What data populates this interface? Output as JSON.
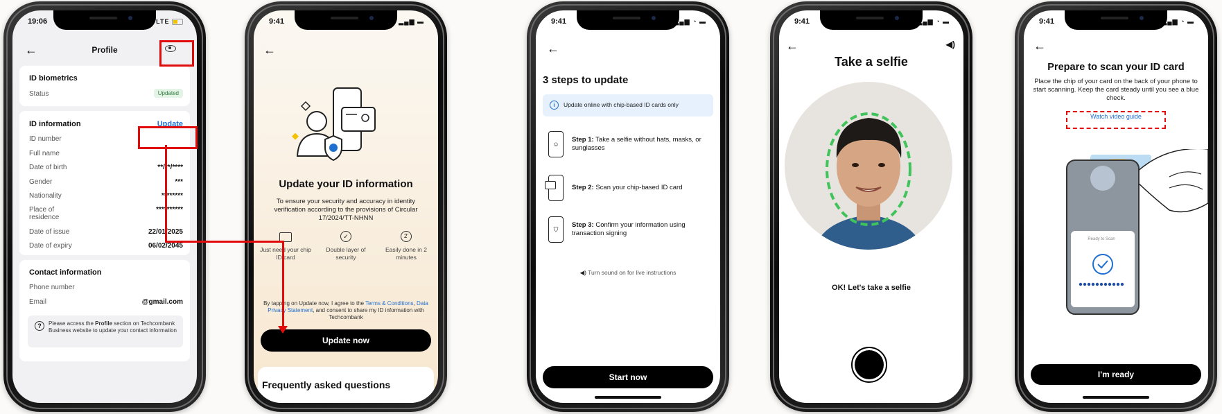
{
  "p1": {
    "time": "19:06",
    "signal": "LTE",
    "title": "Profile",
    "bio_title": "ID biometrics",
    "status_label": "Status",
    "status_badge": "Updated",
    "id_title": "ID information",
    "update": "Update",
    "fields": [
      {
        "label": "ID number",
        "value": ""
      },
      {
        "label": "Full name",
        "value": ""
      },
      {
        "label": "Date of birth",
        "value": "**/**/****"
      },
      {
        "label": "Gender",
        "value": "***"
      },
      {
        "label": "Nationality",
        "value": "********"
      },
      {
        "label": "Place of residence",
        "value": "**********"
      },
      {
        "label": "Date of issue",
        "value": "22/01/2025"
      },
      {
        "label": "Date of expiry",
        "value": "06/02/2045"
      }
    ],
    "contact_title": "Contact information",
    "phone_label": "Phone number",
    "email_label": "Email",
    "email_value": "@gmail.com",
    "note_pre": "Please access the ",
    "note_bold": "Profile",
    "note_post": " section on Techcombank Business website to update your contact information"
  },
  "p2": {
    "time": "9:41",
    "title": "Update your ID information",
    "desc": "To ensure your security and accuracy in identity verification according to the provisions of Circular 17/2024/TT-NHNN",
    "features": [
      {
        "label": "Just need your chip ID card"
      },
      {
        "label": "Double layer of security"
      },
      {
        "label": "Easily done in 2 minutes"
      }
    ],
    "terms_a": "By tapping on Update now, I agree to the ",
    "terms_link1": "Terms & Conditions",
    "terms_b": ", ",
    "terms_link2": "Data Privacy Statement",
    "terms_c": ", and consent to share my ID information with Techcombank",
    "button": "Update now",
    "faq": "Frequently asked questions"
  },
  "p3": {
    "time": "9:41",
    "title": "3 steps to update",
    "info": "Update online with chip-based ID cards only",
    "steps": [
      {
        "bold": "Step 1:",
        "text": " Take a selfie without hats, masks, or sunglasses"
      },
      {
        "bold": "Step 2:",
        "text": " Scan your chip-based ID card"
      },
      {
        "bold": "Step 3:",
        "text": " Confirm your information using transaction signing"
      }
    ],
    "sound": "Turn sound on for live instructions",
    "button": "Start now"
  },
  "p4": {
    "time": "9:41",
    "title": "Take a selfie",
    "caption": "OK! Let's take a selfie"
  },
  "p5": {
    "time": "9:41",
    "title": "Prepare to scan your ID card",
    "desc": "Place the chip of your card on the back of your phone to start scanning. Keep the card steady until you see a blue check.",
    "guide": "Watch video guide",
    "ready_label": "Ready to Scan",
    "button": "I'm ready"
  },
  "colors": {
    "accent": "#1f6fd1",
    "highlight": "#e10b0b",
    "badge_bg": "#e3f3e6",
    "badge_fg": "#2e7d3a",
    "info_bg": "#e6f1fd"
  }
}
